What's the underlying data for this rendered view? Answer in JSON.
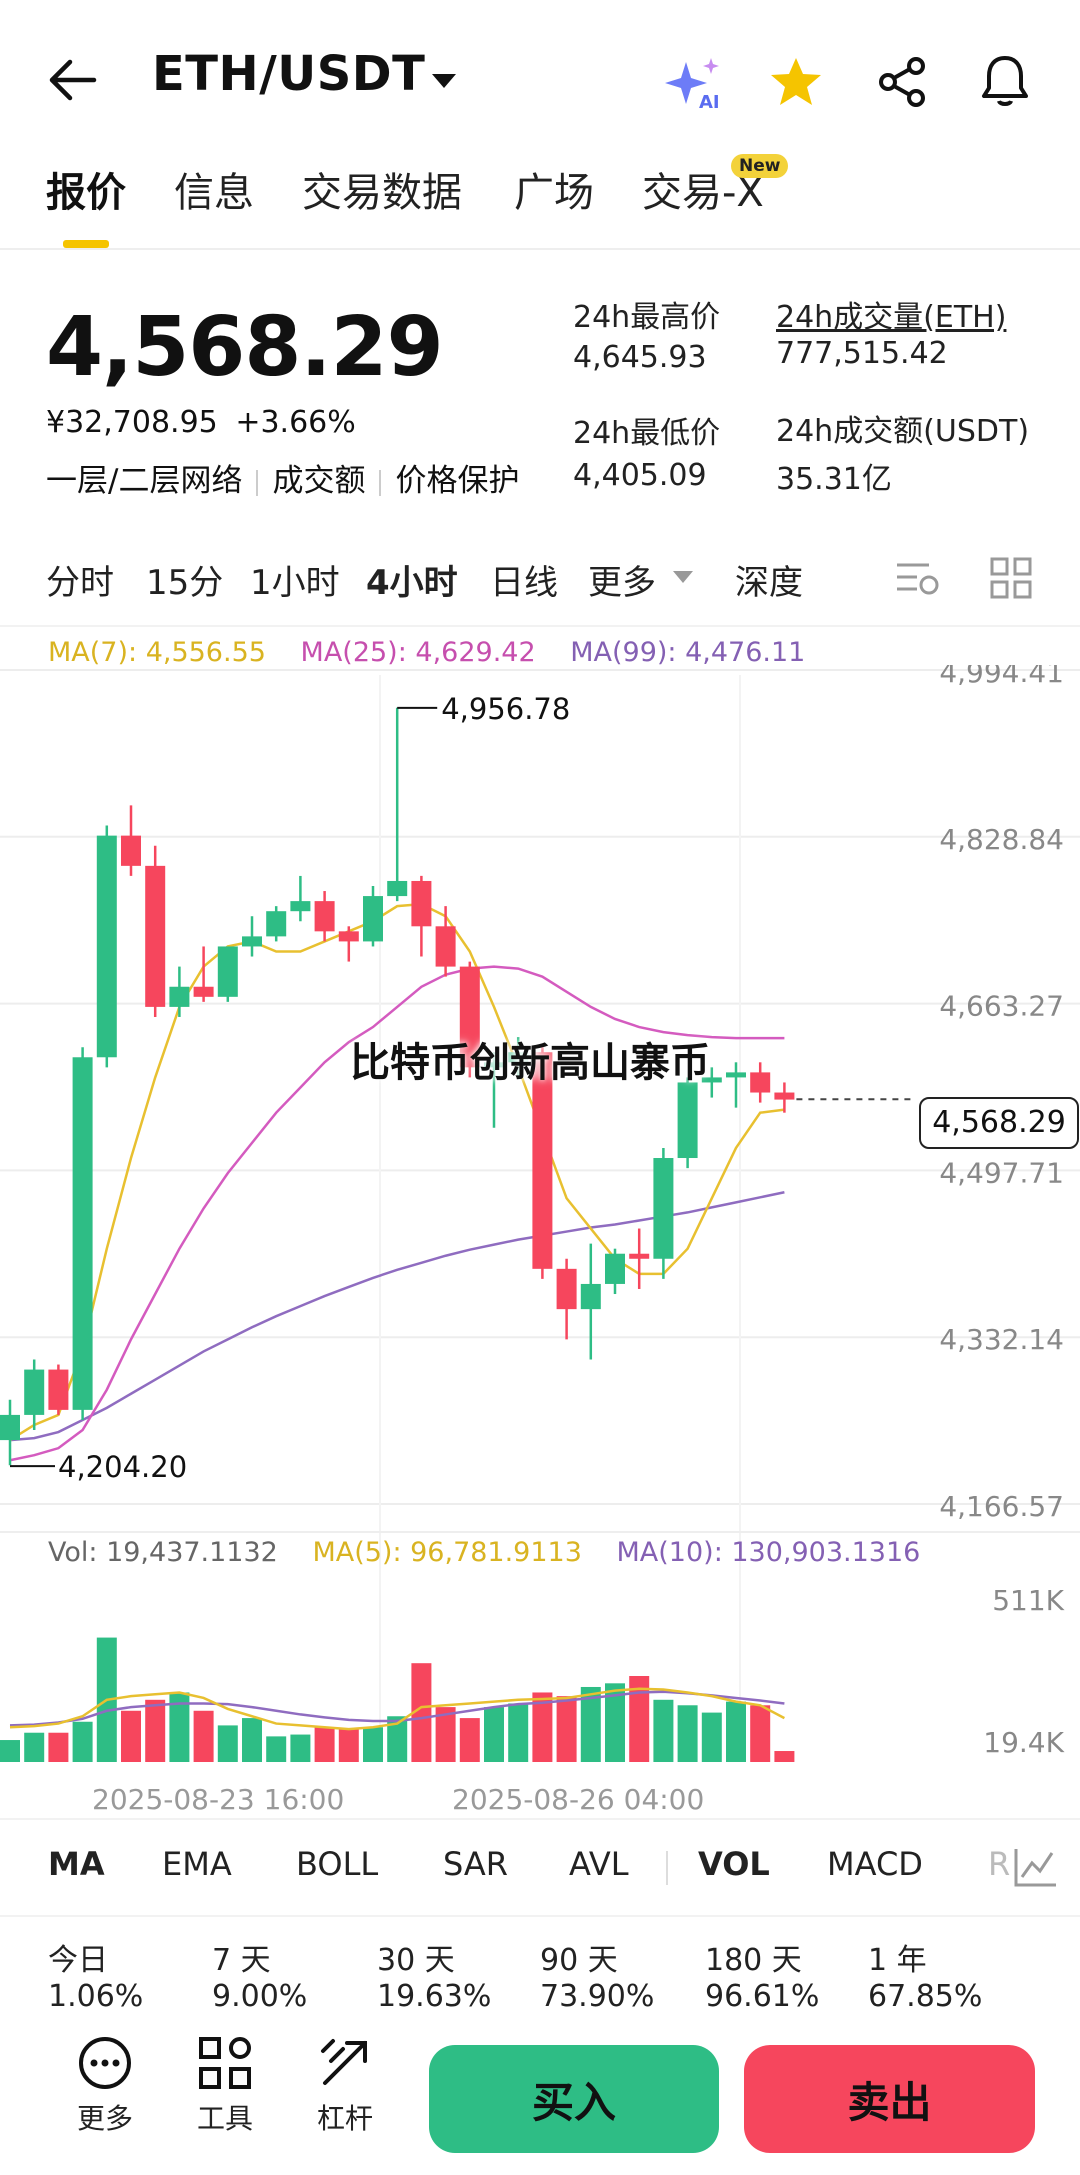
{
  "header": {
    "title": "ETH/USDT",
    "ai_label": "AI",
    "colors": {
      "star": "#f5c400",
      "ai": "#6d7cf7"
    }
  },
  "tabs": [
    {
      "label": "报价",
      "active": true
    },
    {
      "label": "信息"
    },
    {
      "label": "交易数据"
    },
    {
      "label": "广场"
    },
    {
      "label": "交易-X",
      "badge": "New"
    }
  ],
  "ticker": {
    "price": "4,568.29",
    "cny": "¥32,708.95",
    "change": "+3.66%",
    "links": [
      "一层/二层网络",
      "成交额",
      "价格保护"
    ],
    "high_label": "24h最高价",
    "high_value": "4,645.93",
    "low_label": "24h最低价",
    "low_value": "4,405.09",
    "vol_label": "24h成交量(ETH)",
    "vol_value": "777,515.42",
    "amt_label": "24h成交额(USDT)",
    "amt_value": "35.31亿"
  },
  "intervals": [
    "分时",
    "15分",
    "1小时",
    "4小时",
    "日线",
    "更多",
    "深度"
  ],
  "active_interval": "4小时",
  "ma_legend": {
    "ma7": "MA(7): 4,556.55",
    "ma25": "MA(25): 4,629.42",
    "ma99": "MA(99): 4,476.11"
  },
  "vol_legend": {
    "vol": "Vol: 19,437.1132",
    "ma5": "MA(5): 96,781.9113",
    "ma10": "MA(10): 130,903.1316"
  },
  "watermark": "比特币创新高山寨币",
  "chart_data": {
    "type": "candlestick",
    "y_ticks": [
      "4,994.41",
      "4,828.84",
      "4,663.27",
      "4,497.71",
      "4,332.14",
      "4,166.57"
    ],
    "y_tick_values": [
      4994.41,
      4828.84,
      4663.27,
      4497.71,
      4332.14,
      4166.57
    ],
    "ylim": [
      4166.57,
      4994.41
    ],
    "current_price_label": "4,568.29",
    "high_annotation": "4,956.78",
    "low_annotation": "4,204.20",
    "x_labels": [
      "2025-08-23 16:00",
      "2025-08-26 04:00"
    ],
    "vol_ticks": [
      "511K",
      "19.4K"
    ],
    "colors": {
      "up": "#2ebd85",
      "down": "#f6465d",
      "ma7": "#e8c030",
      "ma25": "#d45bbf",
      "ma99": "#8f6cc0"
    },
    "candles": [
      {
        "o": 4230,
        "h": 4270,
        "l": 4205,
        "c": 4255
      },
      {
        "o": 4255,
        "h": 4310,
        "l": 4240,
        "c": 4300
      },
      {
        "o": 4300,
        "h": 4305,
        "l": 4255,
        "c": 4260
      },
      {
        "o": 4260,
        "h": 4620,
        "l": 4250,
        "c": 4610
      },
      {
        "o": 4610,
        "h": 4840,
        "l": 4600,
        "c": 4830
      },
      {
        "o": 4830,
        "h": 4860,
        "l": 4790,
        "c": 4800
      },
      {
        "o": 4800,
        "h": 4820,
        "l": 4650,
        "c": 4660
      },
      {
        "o": 4660,
        "h": 4700,
        "l": 4650,
        "c": 4680
      },
      {
        "o": 4680,
        "h": 4720,
        "l": 4665,
        "c": 4670
      },
      {
        "o": 4670,
        "h": 4720,
        "l": 4665,
        "c": 4720
      },
      {
        "o": 4720,
        "h": 4750,
        "l": 4710,
        "c": 4730
      },
      {
        "o": 4730,
        "h": 4760,
        "l": 4725,
        "c": 4755
      },
      {
        "o": 4755,
        "h": 4790,
        "l": 4745,
        "c": 4765
      },
      {
        "o": 4765,
        "h": 4775,
        "l": 4725,
        "c": 4735
      },
      {
        "o": 4735,
        "h": 4740,
        "l": 4705,
        "c": 4725
      },
      {
        "o": 4725,
        "h": 4780,
        "l": 4720,
        "c": 4770
      },
      {
        "o": 4770,
        "h": 4957,
        "l": 4765,
        "c": 4785
      },
      {
        "o": 4785,
        "h": 4790,
        "l": 4710,
        "c": 4740
      },
      {
        "o": 4740,
        "h": 4760,
        "l": 4690,
        "c": 4700
      },
      {
        "o": 4700,
        "h": 4705,
        "l": 4590,
        "c": 4600
      },
      {
        "o": 4600,
        "h": 4615,
        "l": 4540,
        "c": 4605
      },
      {
        "o": 4605,
        "h": 4630,
        "l": 4590,
        "c": 4615
      },
      {
        "o": 4615,
        "h": 4620,
        "l": 4390,
        "c": 4400
      },
      {
        "o": 4400,
        "h": 4410,
        "l": 4330,
        "c": 4360
      },
      {
        "o": 4360,
        "h": 4425,
        "l": 4310,
        "c": 4385
      },
      {
        "o": 4385,
        "h": 4420,
        "l": 4375,
        "c": 4415
      },
      {
        "o": 4415,
        "h": 4440,
        "l": 4380,
        "c": 4410
      },
      {
        "o": 4410,
        "h": 4520,
        "l": 4390,
        "c": 4510
      },
      {
        "o": 4510,
        "h": 4590,
        "l": 4500,
        "c": 4585
      },
      {
        "o": 4585,
        "h": 4600,
        "l": 4570,
        "c": 4590
      },
      {
        "o": 4590,
        "h": 4605,
        "l": 4560,
        "c": 4595
      },
      {
        "o": 4595,
        "h": 4605,
        "l": 4565,
        "c": 4575
      },
      {
        "o": 4575,
        "h": 4585,
        "l": 4555,
        "c": 4568
      }
    ],
    "ma7": [
      4230,
      4245,
      4255,
      4320,
      4420,
      4510,
      4590,
      4660,
      4700,
      4720,
      4725,
      4715,
      4715,
      4725,
      4735,
      4745,
      4760,
      4762,
      4750,
      4715,
      4660,
      4600,
      4535,
      4470,
      4440,
      4410,
      4395,
      4395,
      4420,
      4470,
      4520,
      4555,
      4558
    ],
    "ma25": [
      4210,
      4215,
      4222,
      4240,
      4280,
      4330,
      4375,
      4420,
      4460,
      4495,
      4525,
      4555,
      4580,
      4605,
      4625,
      4640,
      4660,
      4680,
      4692,
      4698,
      4700,
      4698,
      4690,
      4675,
      4660,
      4648,
      4640,
      4635,
      4632,
      4630,
      4629,
      4629,
      4629
    ],
    "ma99": [
      4230,
      4232,
      4238,
      4250,
      4262,
      4276,
      4290,
      4304,
      4318,
      4330,
      4342,
      4353,
      4363,
      4373,
      4382,
      4391,
      4399,
      4406,
      4413,
      4419,
      4424,
      4429,
      4433,
      4437,
      4441,
      4444,
      4448,
      4452,
      4456,
      4461,
      4466,
      4471,
      4476
    ],
    "volumes": [
      60,
      80,
      80,
      110,
      340,
      140,
      170,
      190,
      140,
      100,
      120,
      70,
      75,
      95,
      90,
      95,
      125,
      270,
      150,
      120,
      150,
      160,
      190,
      180,
      205,
      215,
      235,
      170,
      155,
      135,
      165,
      155,
      30
    ],
    "vol_ma5": [
      95,
      98,
      105,
      125,
      170,
      180,
      185,
      190,
      175,
      145,
      125,
      105,
      100,
      95,
      90,
      95,
      105,
      150,
      155,
      160,
      165,
      170,
      172,
      175,
      185,
      195,
      200,
      198,
      190,
      180,
      165,
      155,
      120
    ],
    "vol_ma10": [
      100,
      102,
      108,
      118,
      140,
      150,
      155,
      160,
      160,
      158,
      150,
      140,
      130,
      122,
      115,
      112,
      112,
      120,
      130,
      140,
      150,
      158,
      162,
      168,
      175,
      182,
      190,
      192,
      188,
      182,
      175,
      168,
      160
    ],
    "vol_max": 511
  },
  "indicators": [
    "MA",
    "EMA",
    "BOLL",
    "SAR",
    "AVL",
    "VOL",
    "MACD",
    "R"
  ],
  "indicators_active": [
    "MA",
    "VOL"
  ],
  "performance": [
    {
      "label": "今日",
      "value": "1.06%"
    },
    {
      "label": "7 天",
      "value": "9.00%"
    },
    {
      "label": "30 天",
      "value": "19.63%"
    },
    {
      "label": "90 天",
      "value": "73.90%"
    },
    {
      "label": "180 天",
      "value": "96.61%"
    },
    {
      "label": "1 年",
      "value": "67.85%"
    }
  ],
  "bottom_bar": {
    "more": "更多",
    "tools": "工具",
    "leverage": "杠杆",
    "buy": "买入",
    "sell": "卖出",
    "buy_color": "#2ebd85",
    "sell_color": "#f6465d"
  }
}
